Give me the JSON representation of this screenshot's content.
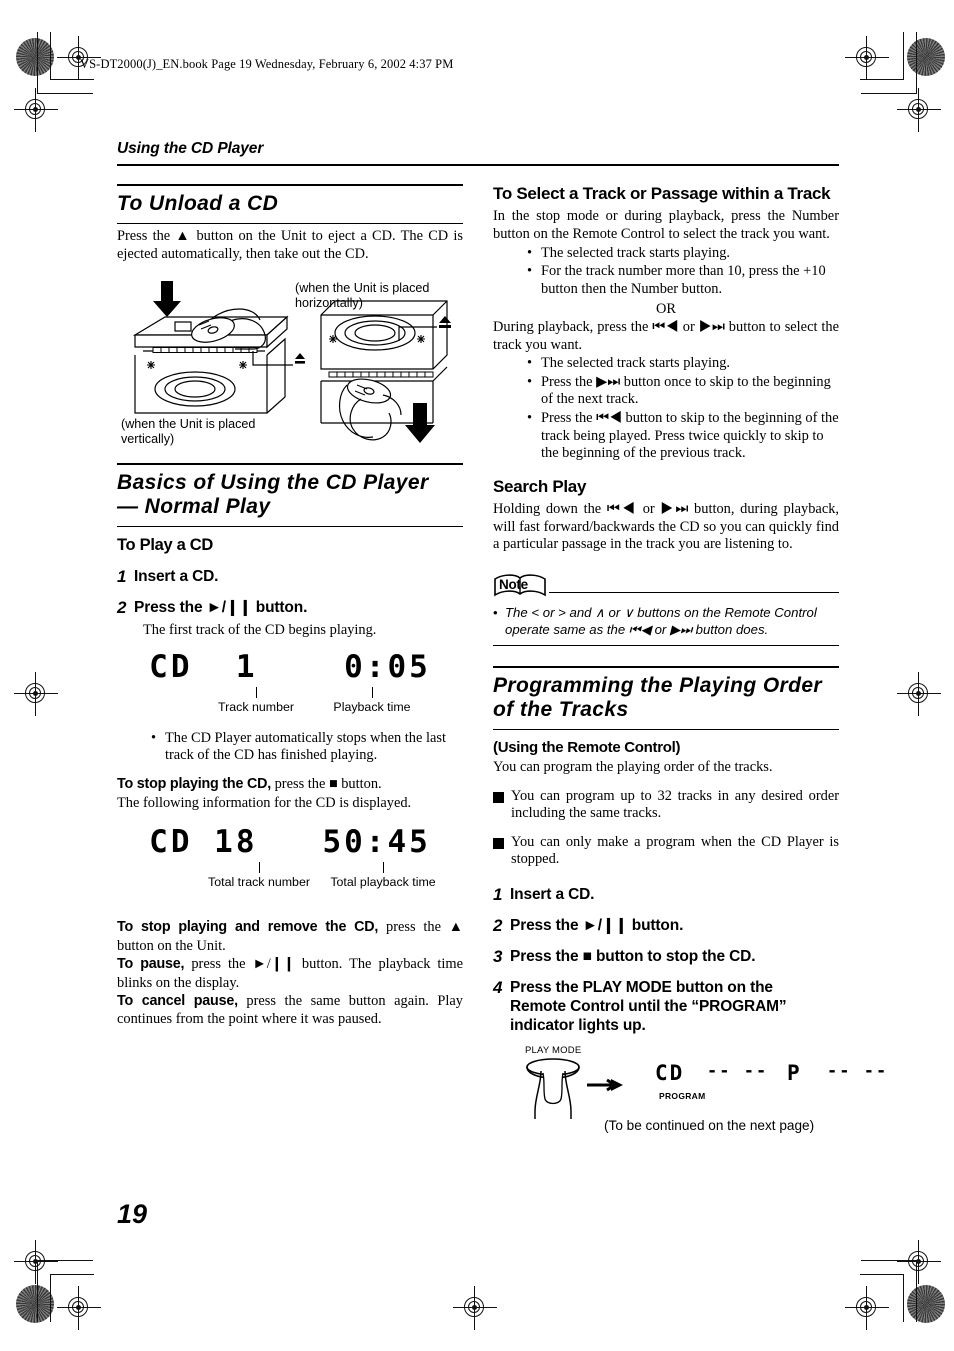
{
  "print": {
    "file_line": "VS-DT2000(J)_EN.book  Page 19  Wednesday, February 6, 2002  4:37 PM"
  },
  "page": {
    "running_head": "Using the CD Player",
    "number": "19",
    "continued": "(To be continued on the next page)"
  },
  "left_column": {
    "unload": {
      "title": "To Unload a CD",
      "body": "Press the ▲ button on the Unit to eject a CD. The CD is ejected automatically, then take out the CD.",
      "figure": {
        "caption_horizontal": "(when the Unit is placed horizontally)",
        "caption_vertical": "(when the Unit is placed vertically)",
        "eject_symbol": "▲"
      }
    },
    "basics": {
      "title_line1": "Basics of Using the CD Player",
      "title_line2": "— Normal Play",
      "subhead": "To Play a CD",
      "steps": [
        {
          "num": "1",
          "text": "Insert a CD."
        },
        {
          "num": "2",
          "text": "Press the ►/❙❙ button."
        }
      ],
      "step2_sub": "The first track of the CD begins playing.",
      "display_play": {
        "text": "CD  1    0:05",
        "callout_track": "Track number",
        "callout_time": "Playback time"
      },
      "bullet_autostop": "The CD Player automatically stops when the last track of the CD has finished playing.",
      "stop_lead": "To stop playing the CD,",
      "stop_rest": " press the ■ button.",
      "stop_line2": "The following information for the CD is displayed.",
      "display_stop": {
        "text": "CD 18   50:45",
        "callout_total_tracks": "Total track number",
        "callout_total_time": "Total playback time"
      },
      "remove_lead": "To stop playing and remove the CD,",
      "remove_rest": " press the ▲ button on the Unit.",
      "pause_lead": "To pause,",
      "pause_rest": " press the ►/❙❙ button. The playback time blinks on the display.",
      "cancel_lead": "To cancel pause,",
      "cancel_rest": " press the same button again. Play continues from the point where it was paused."
    }
  },
  "right_column": {
    "select_track": {
      "title": "To Select a Track or Passage within a Track",
      "body": "In the stop mode or during playback, press the Number button on the Remote Control to select the track you want.",
      "bullets": [
        "The selected track starts playing.",
        "For the track number more than 10, press the +10 button then the Number button."
      ],
      "or": "OR",
      "body2": "During playback, press the ⏮◀ or ▶⏭ button to select the track you want.",
      "bullets2": [
        "The selected track starts playing.",
        "Press the ▶⏭ button once to skip to the beginning of the next track.",
        "Press the ⏮◀ button to skip to the beginning of the track being played. Press twice quickly to skip to the beginning of the previous track."
      ]
    },
    "search_play": {
      "title": "Search Play",
      "body": "Holding down the ⏮◀ or ▶⏭ button, during playback, will fast forward/backwards the CD so you can quickly find a particular passage in the track you are listening to.",
      "note_label": "Note",
      "note_text": "The < or > and ∧ or ∨ buttons on the Remote Control operate same as the ⏮◀ or ▶⏭ button does."
    },
    "programming": {
      "title_line1": "Programming the Playing Order",
      "title_line2": "of the Tracks",
      "subhead": "(Using the Remote Control)",
      "intro": "You can program the playing order of the tracks.",
      "square_items": [
        "You can program up to 32 tracks in any desired order including the same tracks.",
        "You can only make a program when the CD Player is stopped."
      ],
      "steps": [
        {
          "num": "1",
          "text": "Insert a CD."
        },
        {
          "num": "2",
          "text": "Press the ►/❙❙ button."
        },
        {
          "num": "3",
          "text": "Press the ■ button to stop the CD."
        },
        {
          "num": "4",
          "text": "Press the PLAY MODE button on the Remote Control until the “PROGRAM” indicator lights up."
        }
      ],
      "figure": {
        "button_label": "PLAY MODE",
        "arrow": "→",
        "display_left": "CD",
        "display_dashes1": "-- --",
        "program_indicator": "PROGRAM",
        "display_p": "P",
        "display_dashes2": "-- --"
      }
    }
  }
}
